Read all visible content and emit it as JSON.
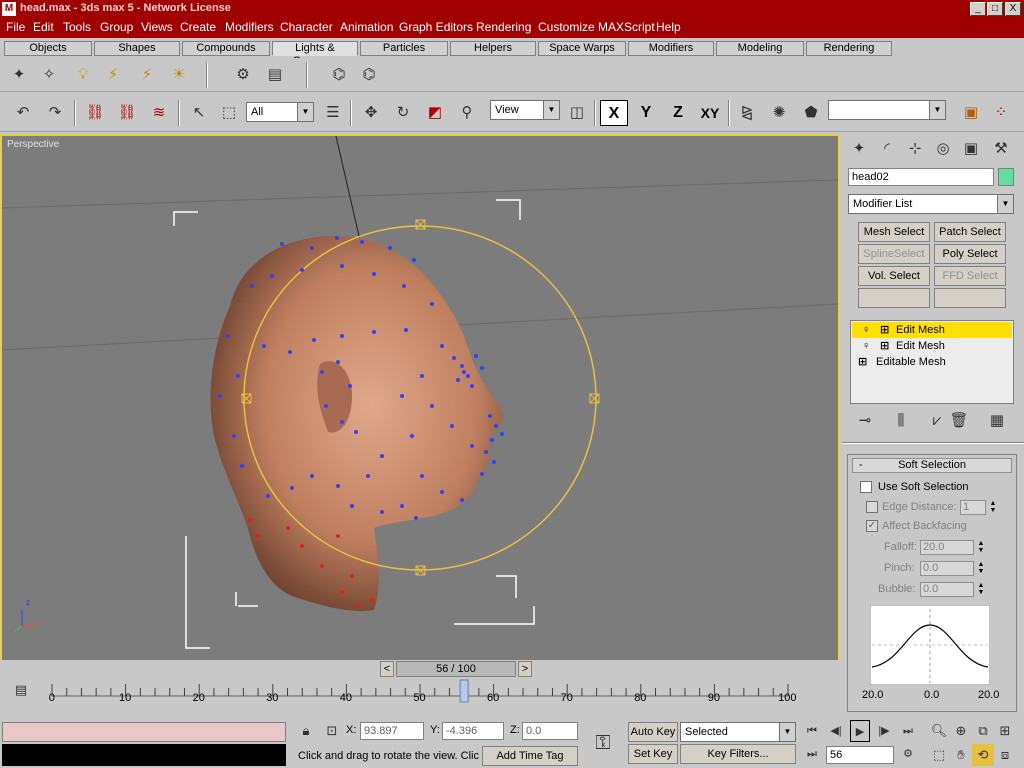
{
  "window": {
    "title": "head.max - 3ds max 5 - Network License",
    "min": "_",
    "max": "□",
    "close": "X"
  },
  "menu": [
    "File",
    "Edit",
    "Tools",
    "Group",
    "Views",
    "Create",
    "Modifiers",
    "Character",
    "Animation",
    "Graph Editors",
    "Rendering",
    "Customize",
    "MAXScript",
    "Help"
  ],
  "tabs": [
    "Objects",
    "Shapes",
    "Compounds",
    "Lights & Cameras",
    "Particles",
    "Helpers",
    "Space Warps",
    "Modifiers",
    "Modeling",
    "Rendering"
  ],
  "toolbar": {
    "selection_filter": "All",
    "ref_coord": "View",
    "axes": [
      "X",
      "Y",
      "Z",
      "XY"
    ],
    "named_selection": ""
  },
  "viewport": {
    "label": "Perspective",
    "axis_z": "z",
    "axis_x": "x"
  },
  "command_panel": {
    "object_name": "head02",
    "modifier_list": "Modifier List",
    "buttons": [
      "Mesh Select",
      "Patch Select",
      "SplineSelect",
      "Poly Select",
      "Vol. Select",
      "FFD Select"
    ],
    "stack": [
      "Edit Mesh",
      "Edit Mesh",
      "Editable Mesh"
    ],
    "soft_selection": {
      "title": "Soft Selection",
      "collapse": "-",
      "use_soft_selection": "Use Soft Selection",
      "edge_distance": "Edge Distance:",
      "edge_distance_value": "1",
      "affect_backfacing": "Affect Backfacing",
      "falloff_label": "Falloff:",
      "falloff_value": "20.0",
      "pinch_label": "Pinch:",
      "pinch_value": "0.0",
      "bubble_label": "Bubble:",
      "bubble_value": "0.0",
      "curve_left": "20.0",
      "curve_mid": "0.0",
      "curve_right": "20.0"
    }
  },
  "time": {
    "frame_display": "56 / 100",
    "ticks": [
      "0",
      "10",
      "20",
      "30",
      "40",
      "50",
      "60",
      "70",
      "80",
      "90",
      "100"
    ],
    "current_frame": 56,
    "total_frames": 100
  },
  "status": {
    "x_label": "X:",
    "x_value": "93.897",
    "y_label": "Y:",
    "y_value": "-4.396",
    "z_label": "Z:",
    "z_value": "0.0",
    "prompt": "Click and drag to rotate the view.  Clic",
    "add_time_tag": "Add Time Tag",
    "auto_key": "Auto Key",
    "set_key": "Set Key",
    "selected": "Selected",
    "key_filters": "Key Filters...",
    "frame": "56"
  }
}
